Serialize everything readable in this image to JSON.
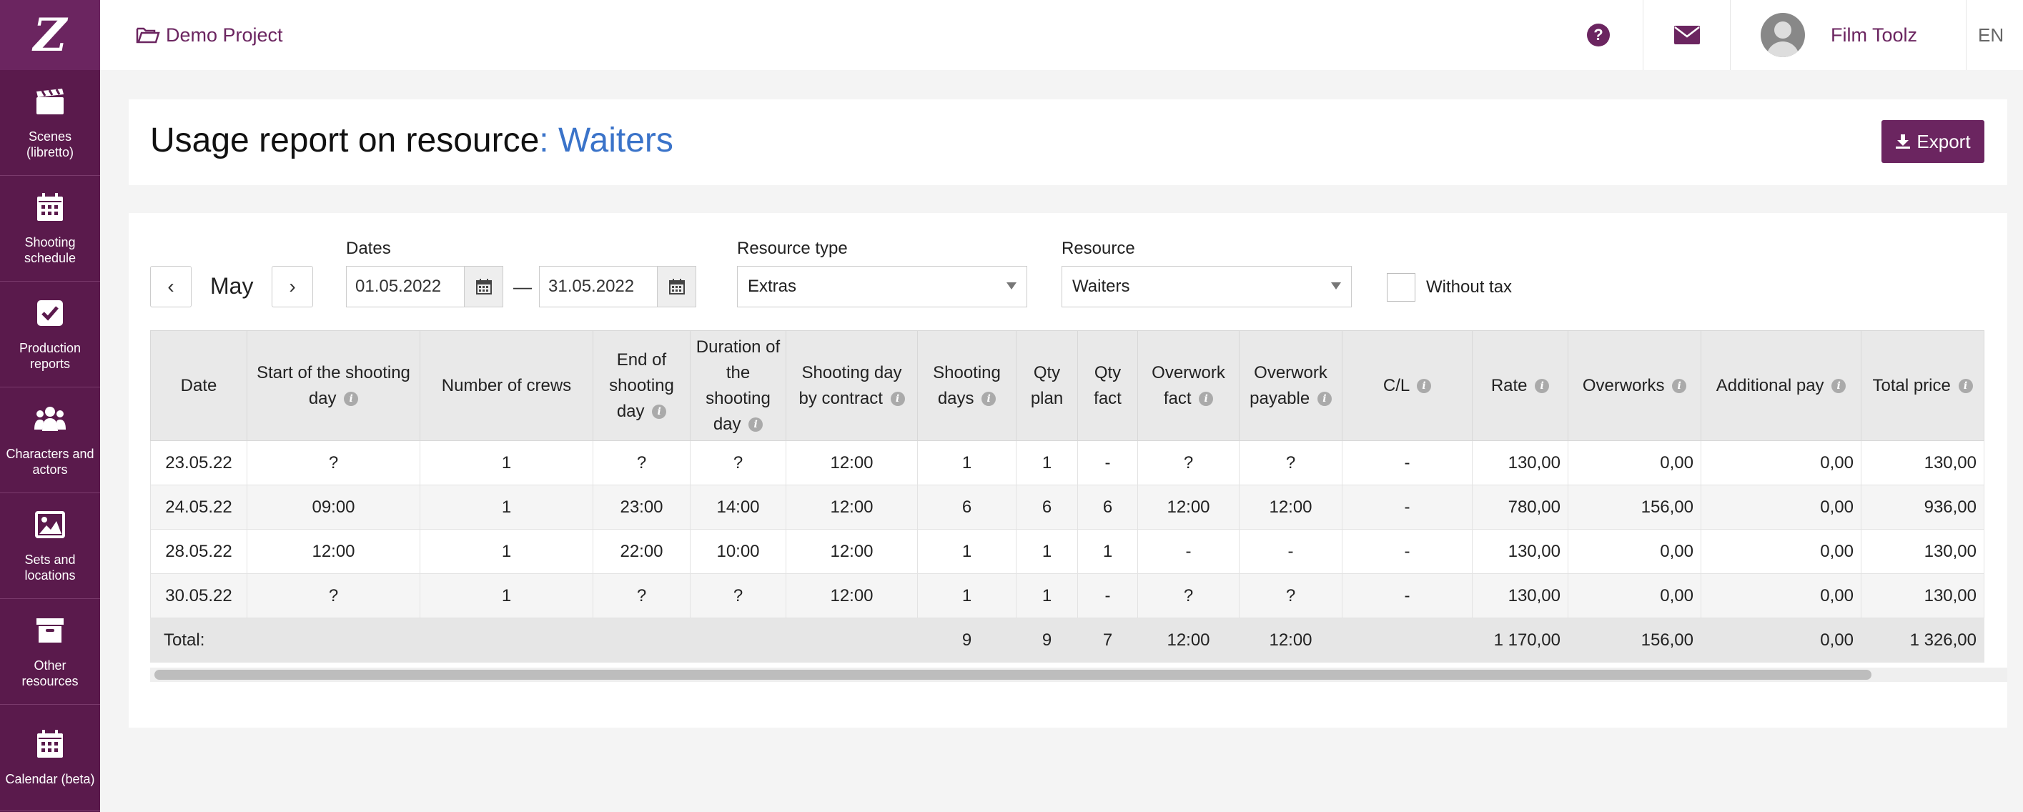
{
  "sidebar": {
    "logo": "Z",
    "items": [
      {
        "label": "Scenes (libretto)",
        "icon": "clapperboard-icon"
      },
      {
        "label": "Shooting schedule",
        "icon": "calendar-icon"
      },
      {
        "label": "Production reports",
        "icon": "checkbox-icon"
      },
      {
        "label": "Characters and actors",
        "icon": "users-icon"
      },
      {
        "label": "Sets and locations",
        "icon": "image-icon"
      },
      {
        "label": "Other resources",
        "icon": "archive-icon"
      },
      {
        "label": "Calendar (beta)",
        "icon": "calendar-icon"
      }
    ]
  },
  "topbar": {
    "project": "Demo Project",
    "user": "Film Toolz",
    "lang": "EN"
  },
  "header": {
    "title_prefix": "Usage report on resource",
    "separator": ":",
    "resource": "Waiters",
    "export_label": "Export"
  },
  "filters": {
    "prev": "‹",
    "next": "›",
    "month": "May",
    "dates_label": "Dates",
    "date_from": "01.05.2022",
    "dash": "—",
    "date_to": "31.05.2022",
    "resource_type_label": "Resource type",
    "resource_type": "Extras",
    "resource_label": "Resource",
    "resource": "Waiters",
    "without_tax": "Without tax"
  },
  "table": {
    "columns": [
      "Date",
      "Start of the shooting day",
      "Number of crews",
      "End of shooting day",
      "Duration of the shooting day",
      "Shooting day by contract",
      "Shooting days",
      "Qty plan",
      "Qty fact",
      "Overwork fact",
      "Overwork payable",
      "C/L",
      "Rate",
      "Overworks",
      "Additional pay",
      "Total price"
    ],
    "rows": [
      [
        "23.05.22",
        "?",
        "1",
        "?",
        "?",
        "12:00",
        "1",
        "1",
        "-",
        "?",
        "?",
        "-",
        "130,00",
        "0,00",
        "0,00",
        "130,00"
      ],
      [
        "24.05.22",
        "09:00",
        "1",
        "23:00",
        "14:00",
        "12:00",
        "6",
        "6",
        "6",
        "12:00",
        "12:00",
        "-",
        "780,00",
        "156,00",
        "0,00",
        "936,00"
      ],
      [
        "28.05.22",
        "12:00",
        "1",
        "22:00",
        "10:00",
        "12:00",
        "1",
        "1",
        "1",
        "-",
        "-",
        "-",
        "130,00",
        "0,00",
        "0,00",
        "130,00"
      ],
      [
        "30.05.22",
        "?",
        "1",
        "?",
        "?",
        "12:00",
        "1",
        "1",
        "-",
        "?",
        "?",
        "-",
        "130,00",
        "0,00",
        "0,00",
        "130,00"
      ]
    ],
    "total": [
      "Total:",
      "",
      "",
      "",
      "",
      "",
      "9",
      "9",
      "7",
      "12:00",
      "12:00",
      "",
      "1 170,00",
      "156,00",
      "0,00",
      "1 326,00"
    ]
  },
  "colors": {
    "brand": "#6b2560",
    "sidebar": "#5a1a4c",
    "link": "#3a73c9"
  }
}
